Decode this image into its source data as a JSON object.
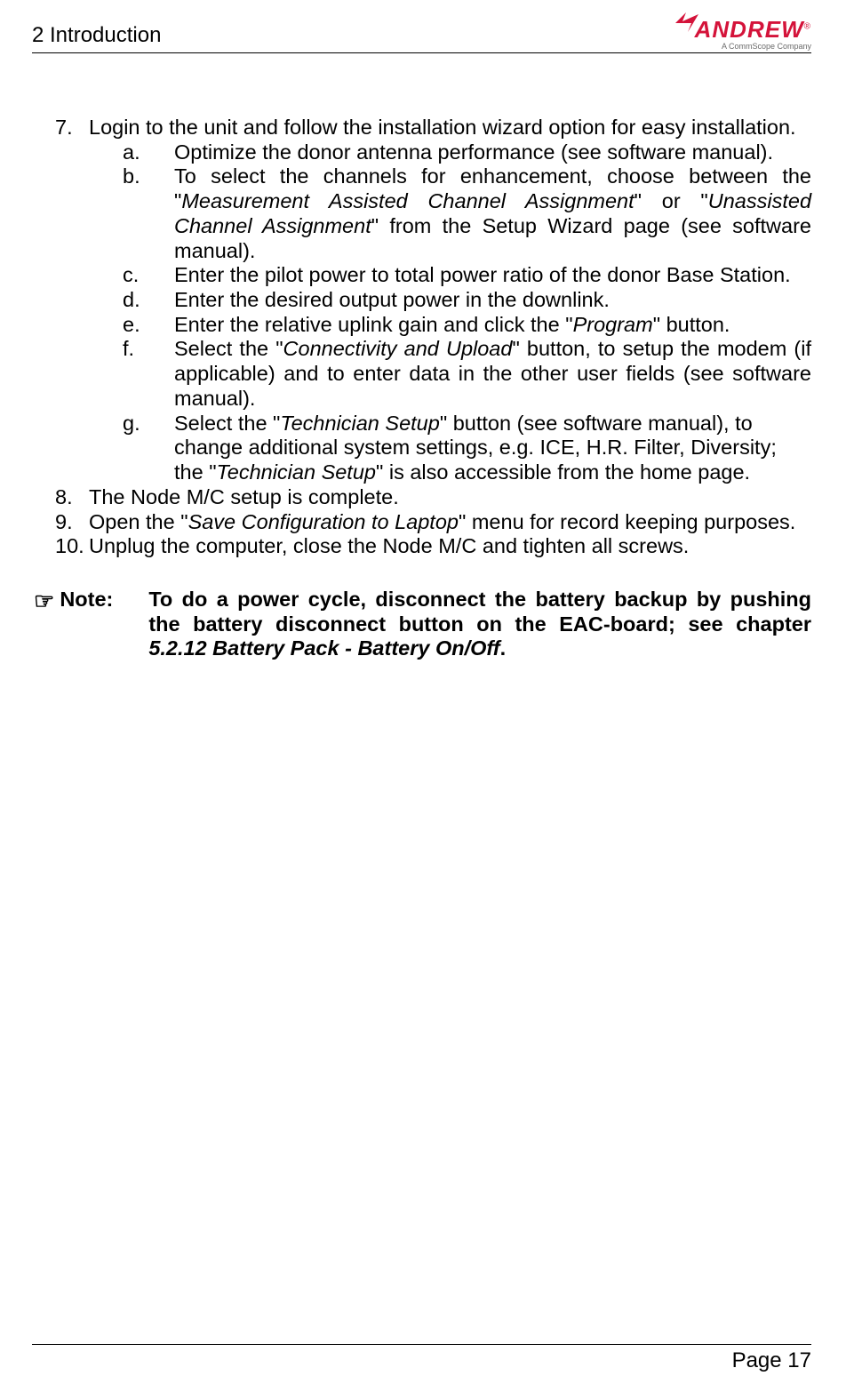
{
  "header": {
    "section_title": "2 Introduction",
    "logo_text": "ANDREW",
    "logo_reg": "®",
    "logo_subtitle": "A CommScope Company"
  },
  "list": {
    "item7": {
      "num": "7.",
      "text": "Login to the unit and follow the installation wizard option for easy installation."
    },
    "sub": {
      "a": {
        "letter": "a.",
        "text": "Optimize the donor antenna performance (see software manual)."
      },
      "b": {
        "letter": "b.",
        "pre": "To select the channels for enhancement, choose between the \"",
        "i1": "Measurement Assisted Channel Assignment",
        "mid": "\" or \"",
        "i2": "Unassisted Channel Assignment",
        "post": "\" from the Setup Wizard page (see software manual)."
      },
      "c": {
        "letter": "c.",
        "text": "Enter the pilot power to total power ratio of the donor Base Station."
      },
      "d": {
        "letter": "d.",
        "text": "Enter the desired output power in the downlink."
      },
      "e": {
        "letter": "e.",
        "pre": "Enter the relative uplink gain and click the \"",
        "i1": "Program",
        "post": "\" button."
      },
      "f": {
        "letter": "f.",
        "pre": "Select the \"",
        "i1": "Connectivity and Upload",
        "post": "\" button, to setup the modem (if applicable) and to enter data in the other user fields (see software manual)."
      },
      "g": {
        "letter": "g.",
        "pre": "Select the \"",
        "i1": "Technician Setup",
        "mid": "\" button (see software manual), to change additional system settings, e.g. ICE, H.R. Filter, Diversity; the \"",
        "i2": "Technician Setup",
        "post": "\" is also accessible from the home page."
      }
    },
    "item8": {
      "num": "8.",
      "text": "The Node M/C setup is complete."
    },
    "item9": {
      "num": "9.",
      "pre": "Open the \"",
      "i1": "Save Configuration to Laptop",
      "post": "\" menu for record keeping purposes."
    },
    "item10": {
      "num": "10.",
      "text": "Unplug the computer, close the Node M/C and tighten all screws."
    }
  },
  "note": {
    "icon": "☞",
    "label": "Note:",
    "line1": "To do a power cycle, disconnect the battery backup by pushing the battery disconnect button on the EAC-board; see chapter ",
    "ref": "5.2.12 Battery Pack - Battery On/Off",
    "tail": "."
  },
  "footer": {
    "page_label": "Page 17"
  }
}
